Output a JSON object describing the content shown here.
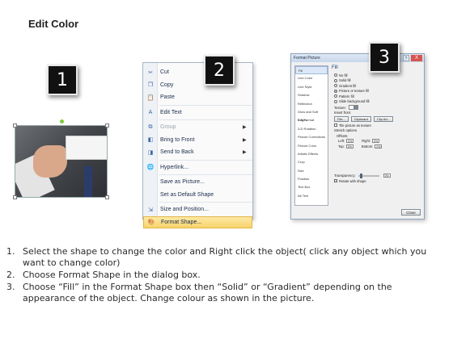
{
  "title": "Edit Color",
  "badges": [
    "1",
    "2",
    "3"
  ],
  "menu": {
    "items": [
      {
        "label": "Cut",
        "icon": "scissors-icon",
        "glyph": "✂",
        "arrow": false,
        "disabled": false
      },
      {
        "label": "Copy",
        "icon": "copy-icon",
        "glyph": "❐",
        "arrow": false,
        "disabled": false
      },
      {
        "label": "Paste",
        "icon": "paste-icon",
        "glyph": "📋",
        "arrow": false,
        "disabled": false
      },
      {
        "label": "Edit Text",
        "icon": "edit-text-icon",
        "glyph": "A",
        "arrow": false,
        "disabled": false
      },
      {
        "label": "Group",
        "icon": "group-icon",
        "glyph": "⧉",
        "arrow": true,
        "disabled": true
      },
      {
        "label": "Bring to Front",
        "icon": "bring-front-icon",
        "glyph": "◧",
        "arrow": true,
        "disabled": false
      },
      {
        "label": "Send to Back",
        "icon": "send-back-icon",
        "glyph": "◨",
        "arrow": true,
        "disabled": false
      },
      {
        "label": "Hyperlink...",
        "icon": "globe-icon",
        "glyph": "🌐",
        "arrow": false,
        "disabled": false
      },
      {
        "label": "Save as Picture...",
        "icon": "",
        "glyph": "",
        "arrow": false,
        "disabled": false
      },
      {
        "label": "Set as Default Shape",
        "icon": "",
        "glyph": "",
        "arrow": false,
        "disabled": false
      },
      {
        "label": "Size and Position...",
        "icon": "size-icon",
        "glyph": "⇲",
        "arrow": false,
        "disabled": false
      },
      {
        "label": "Format Shape...",
        "icon": "paint-bucket-icon",
        "glyph": "🎨",
        "arrow": false,
        "disabled": false,
        "highlighted": true
      }
    ]
  },
  "dialog": {
    "title": "Format Picture",
    "help": "?",
    "close_x": "X",
    "categories": [
      "Fill",
      "Line Color",
      "Line Style",
      "Shadow",
      "Reflection",
      "Glow and Soft Edges",
      "3-D Format",
      "3-D Rotation",
      "Picture Corrections",
      "Picture Color",
      "Artistic Effects",
      "Crop",
      "Size",
      "Position",
      "Text Box",
      "Alt Text"
    ],
    "selected_category": "Fill",
    "heading": "Fill",
    "fill_options": [
      "No fill",
      "Solid fill",
      "Gradient fill",
      "Picture or texture fill",
      "Pattern fill",
      "Slide background fill"
    ],
    "selected_fill": "Picture or texture fill",
    "texture_label": "Texture:",
    "insert_from": "Insert from:",
    "buttons": {
      "file": "File...",
      "clipboard": "Clipboard",
      "clipart": "Clip Art..."
    },
    "tile_label": "Tile picture as texture",
    "stretch_label": "Stretch options",
    "offsets_label": "Offsets:",
    "left_label": "Left:",
    "left_val": "0%",
    "right_label": "Right:",
    "right_val": "0%",
    "top_label": "Top:",
    "top_val": "0%",
    "bottom_label": "Bottom:",
    "bottom_val": "0%",
    "transparency_label": "Transparency:",
    "transparency_val": "0%",
    "rotate_label": "Rotate with shape",
    "close_label": "Close"
  },
  "steps": [
    {
      "num": "1.",
      "text": "Select the shape to change the color and Right click the object( click any object which you want to change color)"
    },
    {
      "num": "2.",
      "text": "Choose Format Shape in the dialog box."
    },
    {
      "num": "3.",
      "text": "Choose “Fill” in the Format Shape box then “Solid” or “Gradient” depending on the appearance of the object. Change colour as shown in the picture."
    }
  ]
}
